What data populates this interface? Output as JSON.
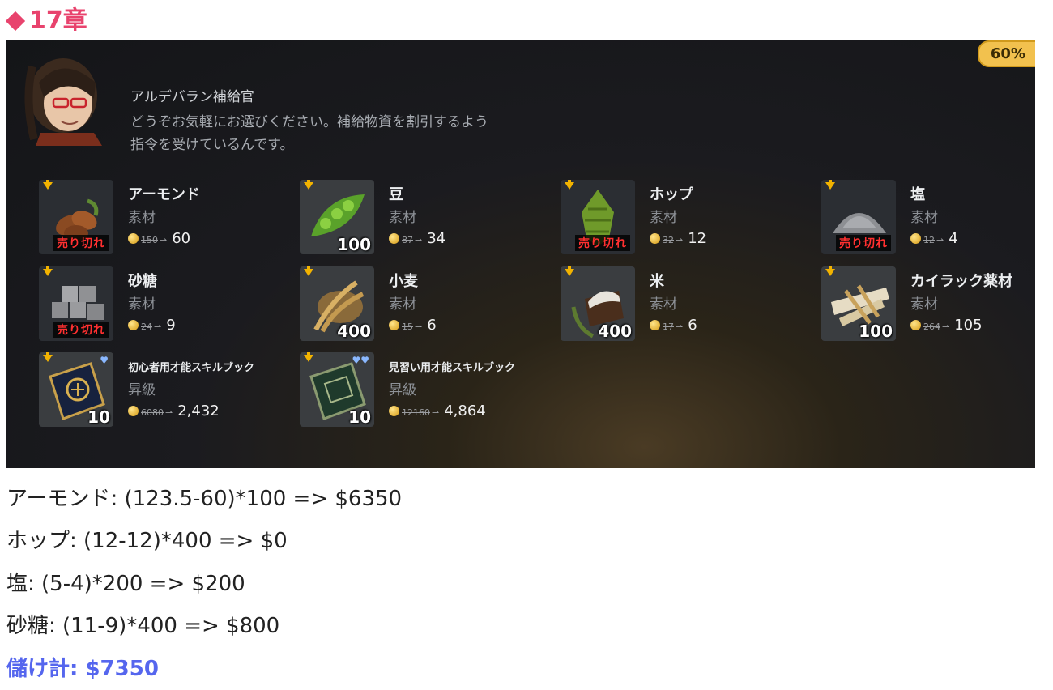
{
  "heading": "17章",
  "colors": {
    "heading": "#e8436d",
    "total": "#5566ee",
    "badge": "#f2c14e"
  },
  "screenshot": {
    "discount_badge": "60%",
    "npc": {
      "name": "アルデバラン補給官",
      "line1": "どうぞお気軽にお選びください。補給物資を割引するよう",
      "line2": "指令を受けているんです。"
    },
    "items": [
      {
        "name": "アーモンド",
        "category": "素材",
        "old_price": "150",
        "price": "60",
        "qty": "",
        "soldout": "売り切れ",
        "icon": "almond-icon"
      },
      {
        "name": "豆",
        "category": "素材",
        "old_price": "87",
        "price": "34",
        "qty": "100",
        "soldout": "",
        "icon": "bean-icon"
      },
      {
        "name": "ホップ",
        "category": "素材",
        "old_price": "32",
        "price": "12",
        "qty": "",
        "soldout": "売り切れ",
        "icon": "hop-icon"
      },
      {
        "name": "塩",
        "category": "素材",
        "old_price": "12",
        "price": "4",
        "qty": "",
        "soldout": "売り切れ",
        "icon": "salt-icon"
      },
      {
        "name": "砂糖",
        "category": "素材",
        "old_price": "24",
        "price": "9",
        "qty": "",
        "soldout": "売り切れ",
        "icon": "sugar-icon"
      },
      {
        "name": "小麦",
        "category": "素材",
        "old_price": "15",
        "price": "6",
        "qty": "400",
        "soldout": "",
        "icon": "wheat-icon"
      },
      {
        "name": "米",
        "category": "素材",
        "old_price": "17",
        "price": "6",
        "qty": "400",
        "soldout": "",
        "icon": "rice-icon"
      },
      {
        "name": "カイラック薬材",
        "category": "素材",
        "old_price": "264",
        "price": "105",
        "qty": "100",
        "soldout": "",
        "icon": "herb-icon"
      },
      {
        "name": "初心者用才能スキルブック",
        "category": "昇級",
        "old_price": "6080",
        "price": "2,432",
        "qty": "10",
        "soldout": "",
        "icon": "skillbook-blue-icon"
      },
      {
        "name": "見習い用才能スキルブック",
        "category": "昇級",
        "old_price": "12160",
        "price": "4,864",
        "qty": "10",
        "soldout": "",
        "icon": "skillbook-green-icon"
      }
    ]
  },
  "calculations": [
    "アーモンド: (123.5-60)*100 => $6350",
    "ホップ: (12-12)*400 => $0",
    "塩: (5-4)*200 => $200",
    "砂糖: (11-9)*400 => $800"
  ],
  "total": "儲け計: $7350"
}
